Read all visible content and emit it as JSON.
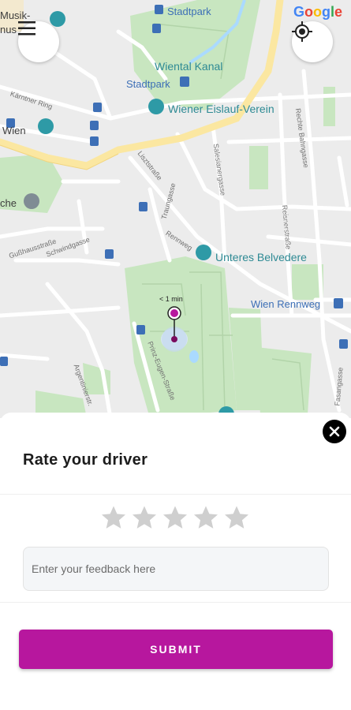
{
  "map": {
    "google_logo": "Google",
    "places": {
      "stadtpark_top": "Stadtpark",
      "wiental_kanal": "Wiental Kanal",
      "stadtpark_station": "Stadtpark",
      "eislauf": "Wiener Eislauf-Verein",
      "unteres_belvedere": "Unteres Belvedere",
      "wien_rennweg": "Wien Rennweg",
      "musik_1": "Musik-",
      "musik_2": "nus",
      "wien_left": "Wien",
      "che_left": "che"
    },
    "streets": {
      "kaerntner_ring": "Kärntner Ring",
      "lisztstrasse": "Lisztstraße",
      "salesianergasse": "Salesianergasse",
      "rechte_bahngasse": "Rechte Bahngasse",
      "traungasse": "Traungasse",
      "rennweg": "Rennweg",
      "reisnerstrasse": "Reisnerstraße",
      "gusshausstrasse": "Gußhausstraße",
      "schwindgasse": "Schwindgasse",
      "prinz_eugen": "Prinz-Eugen-Straße",
      "argentinier": "Argentinierstr.",
      "fasangasse": "Fasangasse"
    },
    "eta_label": "< 1 min"
  },
  "rating": {
    "title": "Rate your driver",
    "star_count": 5,
    "selected_rating": 0,
    "feedback_placeholder": "Enter your feedback here",
    "feedback_value": "",
    "submit_label": "SUBMIT"
  },
  "colors": {
    "accent": "#b7179e",
    "star_empty": "#cfcfcf",
    "park": "#c8e6c0",
    "road": "#ffffff",
    "major_road": "#fbe7a1",
    "water": "#aadaff"
  },
  "icons": {
    "menu": "menu-icon",
    "locate": "my-location-icon",
    "close": "close-icon",
    "star": "star-icon"
  }
}
